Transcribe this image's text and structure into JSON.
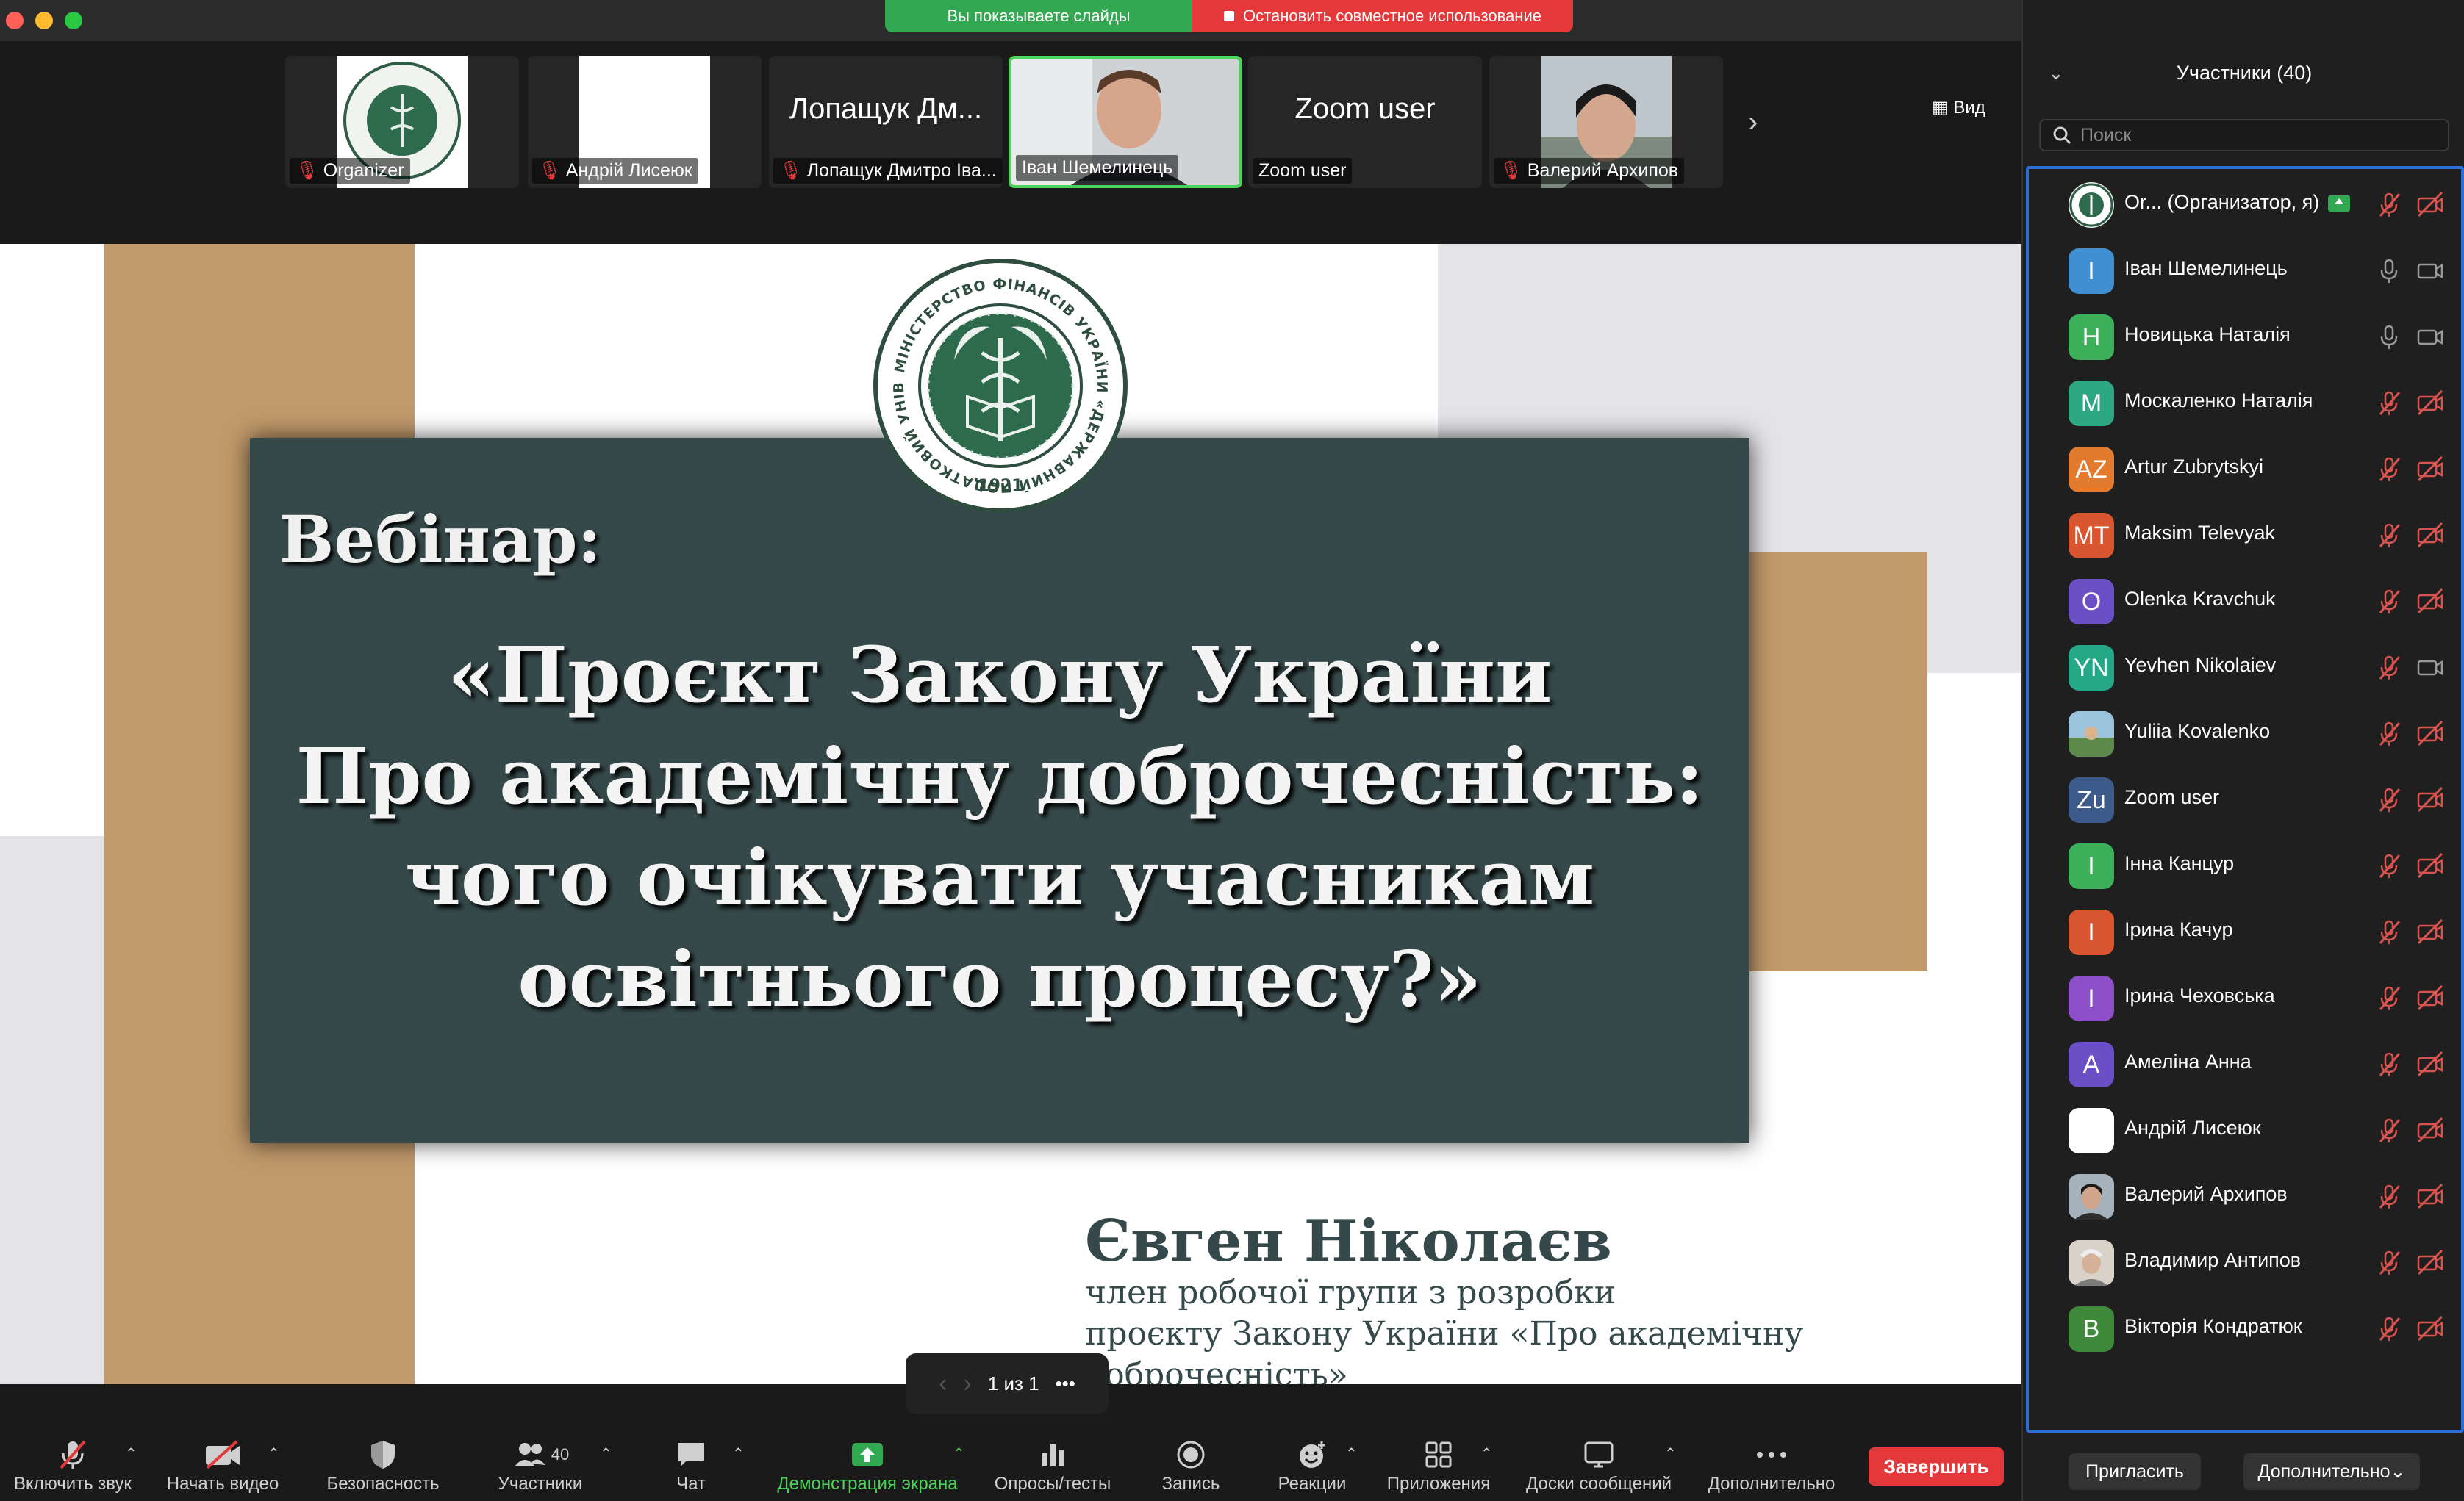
{
  "share_bar": {
    "showing": "Вы показываете слайды",
    "stop": "Остановить совместное использование"
  },
  "gallery": {
    "view_label": "Вид",
    "tiles": [
      {
        "name": "Organizer",
        "muted": true,
        "kind": "seal"
      },
      {
        "name": "Андрій Лисеюк",
        "muted": true,
        "kind": "white"
      },
      {
        "name": "Лопащук Дмитро Іва...",
        "muted": true,
        "kind": "text",
        "big": "Лопащук Дм..."
      },
      {
        "name": "Іван Шемелинець",
        "muted": false,
        "kind": "video"
      },
      {
        "name": "Zoom user",
        "muted": false,
        "kind": "text",
        "big": "Zoom user"
      },
      {
        "name": "Валерий Архипов",
        "muted": true,
        "kind": "photo"
      }
    ]
  },
  "slide": {
    "heading": "Вебінар:",
    "title_lines": [
      "«Проєкт Закону України",
      "Про академічну доброчесність:",
      "чого очікувати учасникам",
      "освітнього процесу?»"
    ],
    "author": "Євген Ніколаєв",
    "role_lines": [
      "член робочої групи з розробки",
      "проєкту Закону України «Про академічну доброчесність»"
    ],
    "seal_text": "МІНІСТЕРСТВО ФІНАНСІВ УКРАЇНИ «ДЕРЖАВНИЙ ПОДАТКОВИЙ УНІВЕРСИТЕТ»",
    "seal_year": "1921",
    "pager": "1 из 1"
  },
  "toolbar": {
    "audio": "Включить звук",
    "video": "Начать видео",
    "security": "Безопасность",
    "participants": "Участники",
    "participants_count": "40",
    "chat": "Чат",
    "share": "Демонстрация экрана",
    "polls": "Опросы/тесты",
    "record": "Запись",
    "reactions": "Реакции",
    "apps": "Приложения",
    "whiteboards": "Доски сообщений",
    "more": "Дополнительно",
    "end": "Завершить"
  },
  "panel": {
    "title": "Участники (40)",
    "search_placeholder": "Поиск",
    "invite": "Пригласить",
    "more": "Дополнительно",
    "participants": [
      {
        "initials": "",
        "name": "Or...   (Организатор, я)",
        "color": "#e9efe9",
        "mic": "muted",
        "cam": "off",
        "photo": "seal",
        "host": true
      },
      {
        "initials": "І",
        "name": "Іван Шемелинець",
        "color": "#3f8fd2",
        "mic": "on",
        "cam": "on"
      },
      {
        "initials": "Н",
        "name": "Новицька Наталія",
        "color": "#3db05a",
        "mic": "on",
        "cam": "on"
      },
      {
        "initials": "М",
        "name": "Москаленко Наталія",
        "color": "#2ea883",
        "mic": "muted",
        "cam": "off"
      },
      {
        "initials": "AZ",
        "name": "Artur Zubrytskyi",
        "color": "#e27b2e",
        "mic": "muted",
        "cam": "off"
      },
      {
        "initials": "MT",
        "name": "Maksim Televyak",
        "color": "#d9552f",
        "mic": "muted",
        "cam": "off"
      },
      {
        "initials": "O",
        "name": "Olenka Kravchuk",
        "color": "#6a4fc7",
        "mic": "muted",
        "cam": "off"
      },
      {
        "initials": "YN",
        "name": "Yevhen Nikolaiev",
        "color": "#25a887",
        "mic": "muted",
        "cam": "on"
      },
      {
        "initials": "",
        "name": "Yuliia Kovalenko",
        "color": "#7aa6c2",
        "mic": "muted",
        "cam": "off",
        "photo": "landscape"
      },
      {
        "initials": "Zu",
        "name": "Zoom user",
        "color": "#3c5a8a",
        "mic": "muted",
        "cam": "off"
      },
      {
        "initials": "І",
        "name": "Інна Канцур",
        "color": "#3db05a",
        "mic": "muted",
        "cam": "off"
      },
      {
        "initials": "І",
        "name": "Ірина Качур",
        "color": "#d9552f",
        "mic": "muted",
        "cam": "off"
      },
      {
        "initials": "І",
        "name": "Ірина Чеховська",
        "color": "#8d4fc7",
        "mic": "muted",
        "cam": "off"
      },
      {
        "initials": "А",
        "name": "Амеліна Анна",
        "color": "#6a4fc7",
        "mic": "muted",
        "cam": "off"
      },
      {
        "initials": "",
        "name": "Андрій Лисеюк",
        "color": "#ffffff",
        "mic": "muted",
        "cam": "off"
      },
      {
        "initials": "",
        "name": "Валерий Архипов",
        "color": "#5a6a7a",
        "mic": "muted",
        "cam": "off",
        "photo": "person"
      },
      {
        "initials": "",
        "name": "Владимир Антипов",
        "color": "#c8c2b8",
        "mic": "muted",
        "cam": "off",
        "photo": "person-light"
      },
      {
        "initials": "В",
        "name": "Вікторія Кондратюк",
        "color": "#3f8a3a",
        "mic": "muted",
        "cam": "off"
      }
    ]
  },
  "colors": {
    "accent_green": "#4cd35a",
    "share_green": "#33a853",
    "stop_red": "#e5383b",
    "slide_panel": "#36494a",
    "slide_tan": "#c19a6b",
    "list_border": "#2d6fd6"
  }
}
